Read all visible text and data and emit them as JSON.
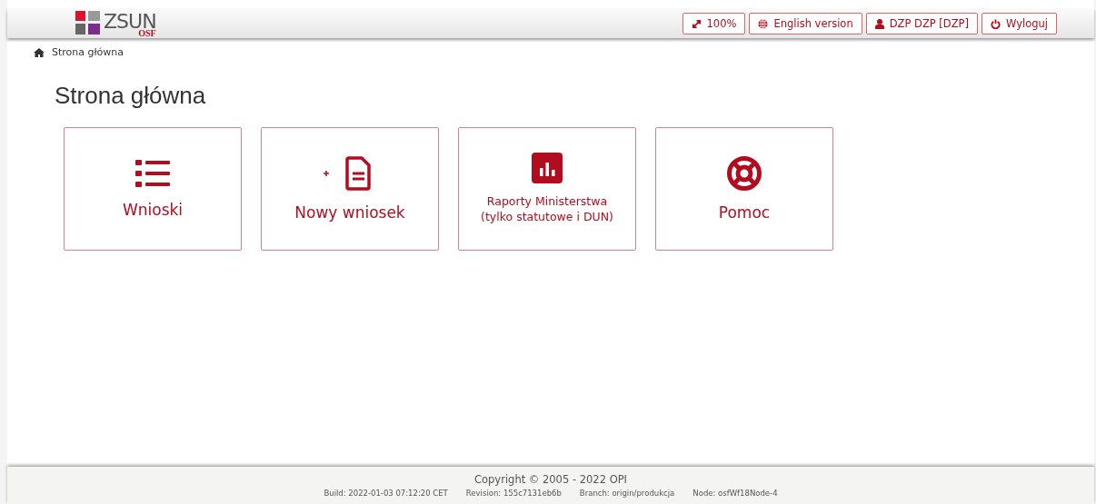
{
  "header": {
    "logo": {
      "name": "ZSUN",
      "sub": "OSF"
    },
    "buttons": [
      {
        "kind": "resize",
        "label": "100%"
      },
      {
        "kind": "globe",
        "label": "English version"
      },
      {
        "kind": "user",
        "label": "DZP DZP [DZP]"
      },
      {
        "kind": "power",
        "label": "Wyloguj"
      }
    ]
  },
  "breadcrumb": {
    "label": "Strona główna"
  },
  "page_title": "Strona główna",
  "tiles": [
    {
      "kind": "list",
      "label": "Wnioski"
    },
    {
      "kind": "new-document",
      "label": "Nowy wniosek"
    },
    {
      "kind": "chart",
      "label": "Raporty Ministerstwa (tylko statutowe i DUN)"
    },
    {
      "kind": "help",
      "label": "Pomoc"
    }
  ],
  "footer": {
    "copyright": "Copyright © 2005 - 2022 OPI",
    "details": [
      "Build: 2022-01-03 07:12:20 CET",
      "Revision: 155c7131eb6b",
      "Branch: origin/produkcja",
      "Node: osfWf18Node-4"
    ]
  }
}
